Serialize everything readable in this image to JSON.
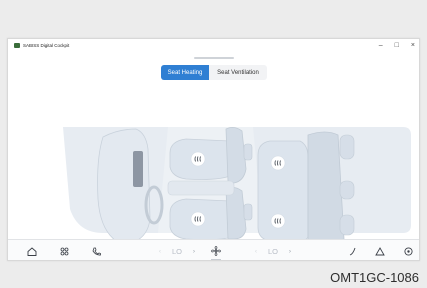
{
  "window": {
    "title": "SABISS Digital Cockpit"
  },
  "window_controls": {
    "minimize": "–",
    "maximize": "□",
    "close": "×"
  },
  "tabs": [
    {
      "label": "Seat Heating",
      "active": true
    },
    {
      "label": "Seat Ventilation",
      "active": false
    }
  ],
  "seat_icons": [
    "heat-icon",
    "heat-icon",
    "heat-icon",
    "heat-icon",
    "heat-icon"
  ],
  "bottom_bar": {
    "left_temp": {
      "value": "LO"
    },
    "right_temp": {
      "value": "LO"
    },
    "icons": [
      "home-icon",
      "apps-icon",
      "phone-icon",
      "chevron-left-icon",
      "chevron-right-icon",
      "fan-icon",
      "chevron-left-icon",
      "chevron-right-icon",
      "wiper-icon",
      "warning-triangle-icon",
      "settings-icon"
    ]
  },
  "caption": "OMT1GC-1086",
  "colors": {
    "accent": "#2f7fd3",
    "seat": "#dde5ee",
    "floor": "#e6ebf1"
  }
}
